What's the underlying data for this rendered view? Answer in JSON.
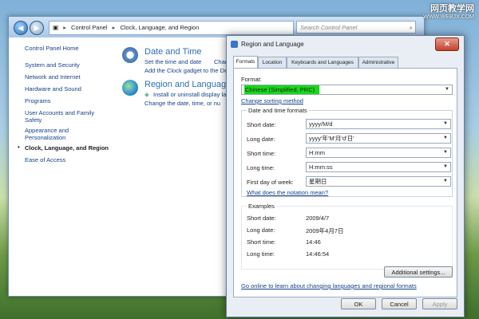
{
  "control_panel": {
    "address": {
      "crumb1": "Control Panel",
      "crumb2": "Clock, Language, and Region",
      "sep": "▸"
    },
    "search": {
      "placeholder": "Search Control Panel"
    },
    "sidebar": [
      {
        "label": "Control Panel Home"
      },
      {
        "label": "System and Security"
      },
      {
        "label": "Network and Internet"
      },
      {
        "label": "Hardware and Sound"
      },
      {
        "label": "Programs"
      },
      {
        "label": "User Accounts and Family Safety"
      },
      {
        "label": "Appearance and Personalization"
      },
      {
        "label": "Clock, Language, and Region"
      },
      {
        "label": "Ease of Access"
      }
    ],
    "categories": [
      {
        "title": "Date and Time",
        "links": [
          "Set the time and date",
          "Change",
          "Add the Clock gadget to the Desktop"
        ]
      },
      {
        "title": "Region and Language",
        "links": [
          "Install or uninstall display la",
          "Change the date, time, or nu"
        ]
      }
    ]
  },
  "dialog": {
    "title": "Region and Language",
    "close_label": "✕",
    "tabs": [
      "Formats",
      "Location",
      "Keyboards and Languages",
      "Administrative"
    ],
    "format_label": "Format:",
    "format_value": "Chinese (Simplified, PRC)",
    "change_sorting": "Change sorting method",
    "group_title": "Date and time formats",
    "fields": [
      {
        "label": "Short date:",
        "value": "yyyy/M/d"
      },
      {
        "label": "Long date:",
        "value": "yyyy'年'M'月'd'日'"
      },
      {
        "label": "Short time:",
        "value": "H:mm"
      },
      {
        "label": "Long time:",
        "value": "H:mm:ss"
      },
      {
        "label": "First day of week:",
        "value": "星期日"
      }
    ],
    "notation_link": "What does the notation mean?",
    "examples_title": "Examples",
    "examples": [
      {
        "label": "Short date:",
        "value": "2009/4/7"
      },
      {
        "label": "Long date:",
        "value": "2009年4月7日"
      },
      {
        "label": "Short time:",
        "value": "14:46"
      },
      {
        "label": "Long time:",
        "value": "14:46:54"
      }
    ],
    "additional_settings": "Additional settings...",
    "online_link": "Go online to learn about changing languages and regional formats",
    "ok": "OK",
    "cancel": "Cancel",
    "apply": "Apply"
  },
  "watermark": {
    "line1": "网页教学网",
    "line2": "WWW.WEBJX.COM"
  }
}
